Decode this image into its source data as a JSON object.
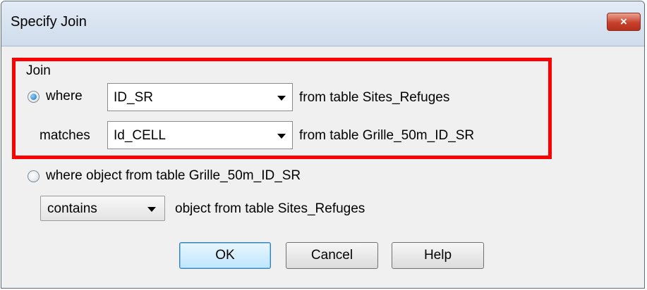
{
  "dialog": {
    "title": "Specify Join",
    "close_icon": "×"
  },
  "join_group": {
    "label": "Join",
    "where_label": "where",
    "where_selected": true,
    "where_value": "ID_SR",
    "where_suffix": "from table Sites_Refuges",
    "matches_label": "matches",
    "matches_value": "Id_CELL",
    "matches_suffix": "from table Grille_50m_ID_SR"
  },
  "object_option": {
    "label": "where object from table Grille_50m_ID_SR",
    "selected": false,
    "operator_value": "contains",
    "suffix": "object from table Sites_Refuges"
  },
  "buttons": {
    "ok": "OK",
    "cancel": "Cancel",
    "help": "Help"
  },
  "colors": {
    "highlight_frame": "#ff0000",
    "close_button": "#c8412c"
  }
}
